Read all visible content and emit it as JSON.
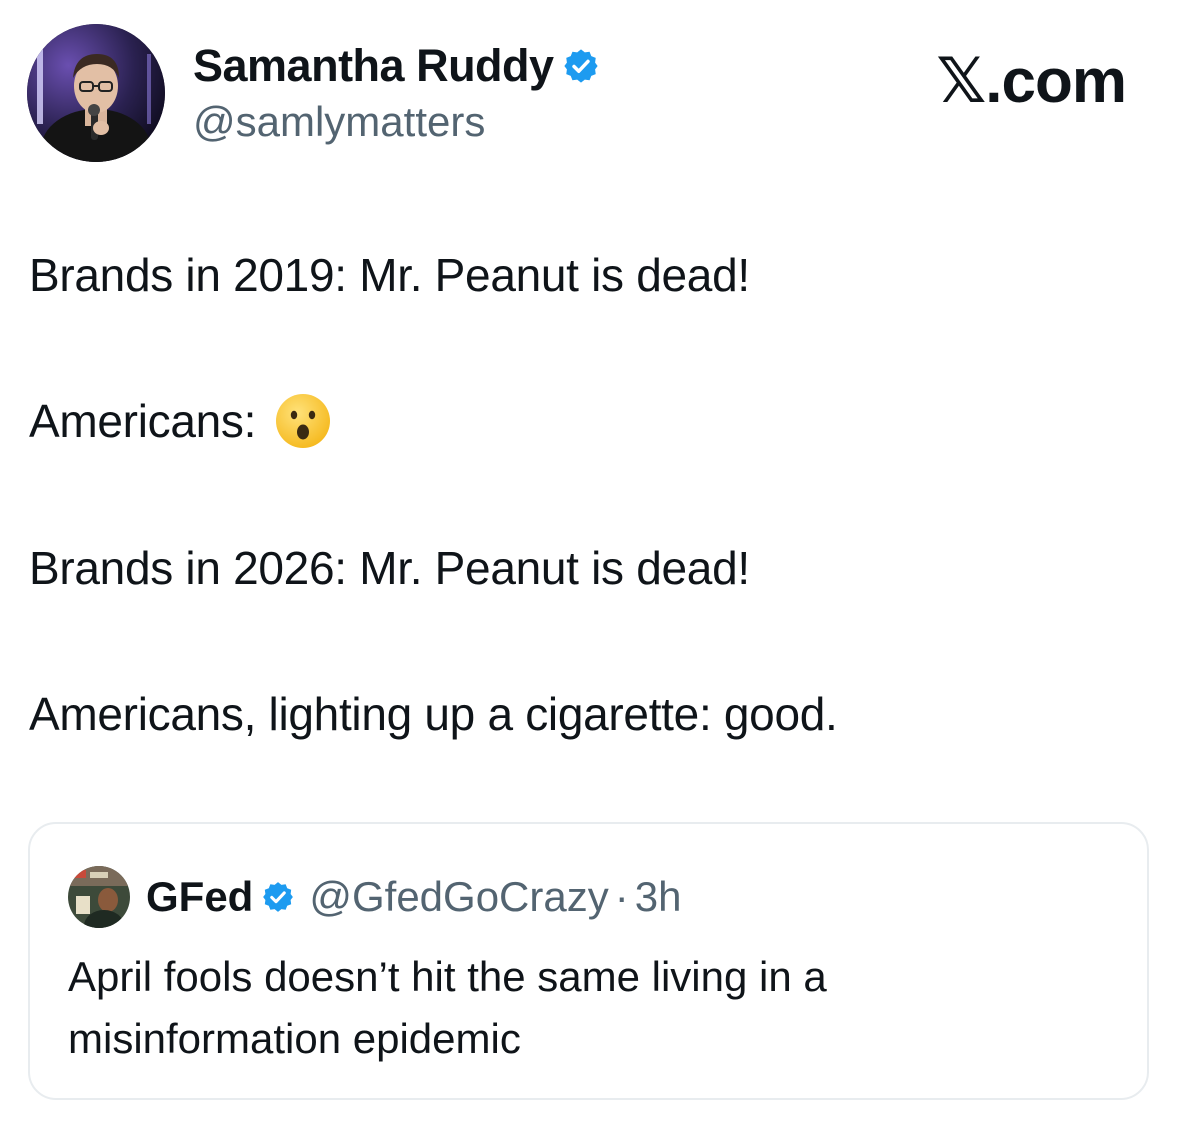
{
  "author": {
    "display_name": "Samantha Ruddy",
    "handle": "@samlymatters",
    "verified_icon": "verified-badge-icon"
  },
  "brand": {
    "label": "𝕏.com"
  },
  "tweet": {
    "line1": "Brands in 2019: Mr. Peanut is dead!",
    "line2": "Americans:",
    "line2_emoji": "astonished-face-emoji",
    "line3": "Brands in 2026: Mr. Peanut is dead!",
    "line4": "Americans, lighting up a cigarette: good."
  },
  "quote": {
    "display_name": "GFed",
    "handle": "@GfedGoCrazy",
    "separator": "·",
    "time": "3h",
    "text": "April fools doesn’t hit the same living in a misinformation epidemic"
  },
  "colors": {
    "verified_blue": "#1d9bf0",
    "secondary_text": "#536471",
    "border": "#e8ecef"
  }
}
